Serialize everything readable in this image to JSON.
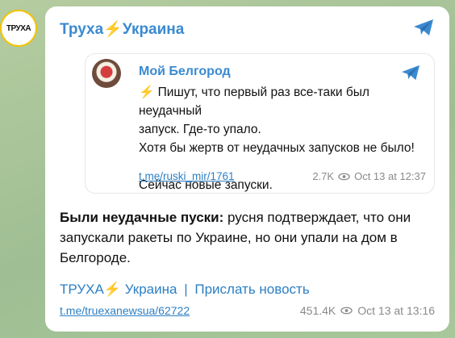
{
  "channel": {
    "name_part1": "Труха",
    "bolt": "⚡",
    "name_part2": "Украина",
    "avatar_text": "ТРУХА"
  },
  "forwarded": {
    "source": "Мой Белгород",
    "lines": [
      "Пишут, что первый раз все-таки был неудачный",
      "запуск. Где-то упало.",
      "Хотя бы жертв от неудачных запусков не было!",
      "",
      "Сейчас новые запуски."
    ],
    "link": "t.me/ruski_mir/1761",
    "views": "2.7K",
    "time": "Oct 13 at 12:37"
  },
  "message": {
    "bold_intro": "Были неудачные пуски:",
    "text": " русня подтверждает, что они запускали ракеты по Украине, но они упали на дом в Белгороде.",
    "footer_brand_part1": "ТРУХА",
    "footer_brand_part2": "Украина",
    "separator": "|",
    "send_news": "Прислать новость",
    "link": "t.me/truexanewsua/62722",
    "views": "451.4K",
    "time": "Oct 13 at 13:16"
  },
  "colors": {
    "accent": "#3a8ad0",
    "link": "#2c7fc4",
    "bolt": "#f2b600",
    "background": "#a9c39a"
  },
  "icons": [
    "telegram-send-icon",
    "eye-icon",
    "lightning-icon"
  ]
}
